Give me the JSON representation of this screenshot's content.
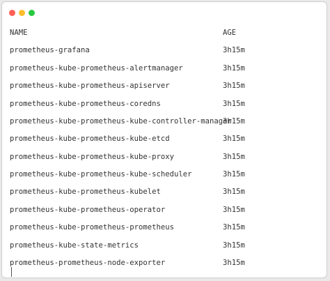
{
  "window": {
    "controls": {
      "close_color": "#ff5f57",
      "minimize_color": "#ffbd2e",
      "zoom_color": "#28c940"
    }
  },
  "terminal": {
    "headers": {
      "name": "NAME",
      "age": "AGE"
    },
    "rows": [
      {
        "name": "prometheus-grafana",
        "age": "3h15m"
      },
      {
        "name": "prometheus-kube-prometheus-alertmanager",
        "age": "3h15m"
      },
      {
        "name": "prometheus-kube-prometheus-apiserver",
        "age": "3h15m"
      },
      {
        "name": "prometheus-kube-prometheus-coredns",
        "age": "3h15m"
      },
      {
        "name": "prometheus-kube-prometheus-kube-controller-manager",
        "age": "3h15m"
      },
      {
        "name": "prometheus-kube-prometheus-kube-etcd",
        "age": "3h15m"
      },
      {
        "name": "prometheus-kube-prometheus-kube-proxy",
        "age": "3h15m"
      },
      {
        "name": "prometheus-kube-prometheus-kube-scheduler",
        "age": "3h15m"
      },
      {
        "name": "prometheus-kube-prometheus-kubelet",
        "age": "3h15m"
      },
      {
        "name": "prometheus-kube-prometheus-operator",
        "age": "3h15m"
      },
      {
        "name": "prometheus-kube-prometheus-prometheus",
        "age": "3h15m"
      },
      {
        "name": "prometheus-kube-state-metrics",
        "age": "3h15m"
      },
      {
        "name": "prometheus-prometheus-node-exporter",
        "age": "3h15m"
      }
    ]
  }
}
